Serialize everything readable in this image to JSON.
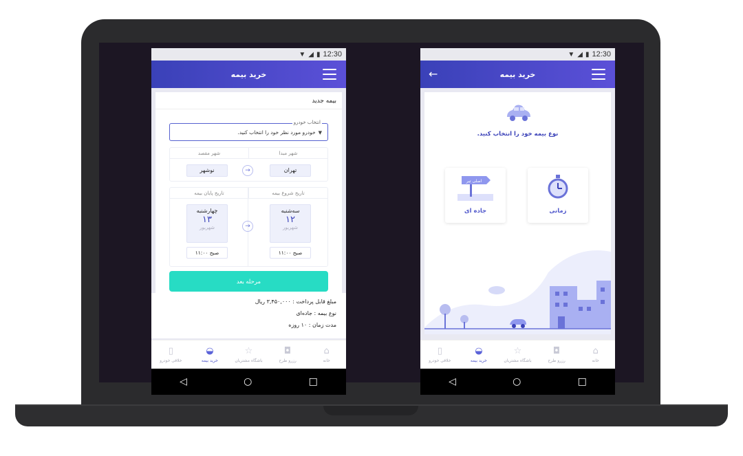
{
  "status_time": "12:30",
  "left_screen": {
    "header_title": "خرید بیمه",
    "card_title": "بیمه جدید",
    "vehicle_select": {
      "legend": "انتخاب خودرو",
      "placeholder": "خودرو مورد نظر خود را انتخاب کنید."
    },
    "origin_label": "شهر مبدا",
    "destination_label": "شهر مقصد",
    "origin_city": "تهران",
    "destination_city": "نوشهر",
    "start_date_label": "تاریخ  شروع بیمه",
    "end_date_label": "تاریخ  پایان بیمه",
    "start_date": {
      "day": "سه‌شنبه",
      "num": "۱۲",
      "month": "شهریور",
      "time": "صبح  ۱۱:۰۰"
    },
    "end_date": {
      "day": "چهارشنبه",
      "num": "۱۳",
      "month": "شهریور",
      "time": "صبح  ۱۱:۰۰"
    },
    "next_button": "مرحله بعد",
    "summary": {
      "amount": "مبلغ قابل پرداخت : ۳,۴۵۰,۰۰۰ ریال",
      "type": "نوع بیمه : جاده‌ای",
      "duration": "مدت زمان : ۱۰ روزه"
    }
  },
  "right_screen": {
    "header_title": "خرید بیمه",
    "prompt": "نوع بیمه خود را انتخاب کنید.",
    "option_road": "جاده ای",
    "option_time": "زمانی",
    "sign_text": "اصلی تیر"
  },
  "bottom_nav": [
    {
      "label": "خلافی خودرو",
      "icon": "traffic-light-icon"
    },
    {
      "label": "خرید بیمه",
      "icon": "car-icon",
      "active": true
    },
    {
      "label": "باشگاه مشتریان",
      "icon": "star-icon"
    },
    {
      "label": "رزرو طرح",
      "icon": "stamp-icon"
    },
    {
      "label": "خانه",
      "icon": "home-icon"
    }
  ],
  "colors": {
    "accent": "#3a41b8",
    "button": "#27dcc4"
  }
}
